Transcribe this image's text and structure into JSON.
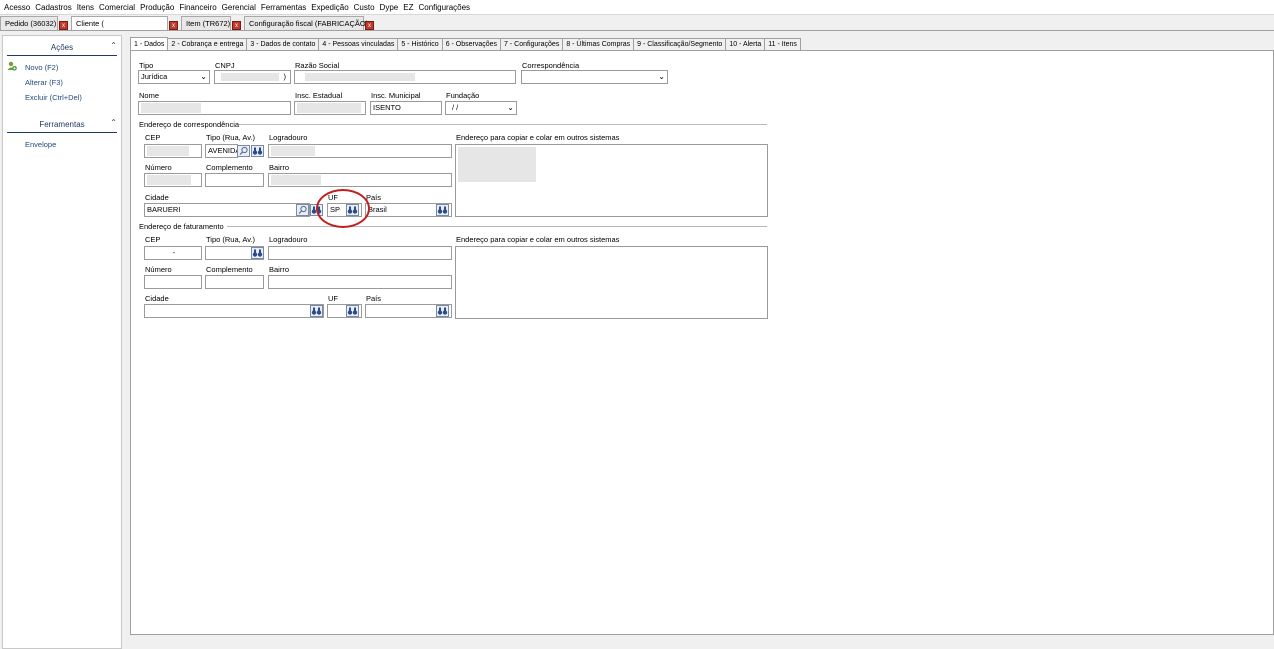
{
  "menu": [
    "Acesso",
    "Cadastros",
    "Itens",
    "Comercial",
    "Produção",
    "Financeiro",
    "Gerencial",
    "Ferramentas",
    "Expedição",
    "Custo",
    "Dype",
    "EZ",
    "Configurações"
  ],
  "doc_tabs": [
    {
      "label": "Pedido (36032)"
    },
    {
      "label": "Cliente (",
      "active": true
    },
    {
      "label": "Item (TR672)"
    },
    {
      "label": "Configuração fiscal (FABRICAÇÃO)"
    }
  ],
  "sidebar": {
    "acoes_title": "Ações",
    "actions": [
      "Novo (F2)",
      "Alterar (F3)",
      "Excluir (Ctrl+Del)"
    ],
    "ferramentas_title": "Ferramentas",
    "tools": [
      "Envelope"
    ]
  },
  "page_tabs": [
    "1 - Dados",
    "2 - Cobrança e entrega",
    "3 - Dados de contato",
    "4 - Pessoas vinculadas",
    "5 - Histórico",
    "6 - Observações",
    "7 - Configurações",
    "8 - Últimas Compras",
    "9 - Classificação/Segmento",
    "10 - Alerta",
    "11 - Itens"
  ],
  "form": {
    "tipo_label": "Tipo",
    "tipo_value": "Jurídica",
    "cnpj_label": "CNPJ",
    "cnpj_tail": ")",
    "razao_label": "Razão Social",
    "correspondencia_label": "Correspondência",
    "nome_label": "Nome",
    "insc_estadual_label": "Insc. Estadual",
    "insc_municipal_label": "Insc. Municipal",
    "insc_municipal_value": "ISENTO",
    "fundacao_label": "Fundação",
    "fundacao_value": "/ /"
  },
  "corresp": {
    "group_title": "Endereço de correspondência",
    "cep_label": "CEP",
    "tipo_label": "Tipo (Rua, Av.)",
    "tipo_value": "AVENIDA",
    "logradouro_label": "Logradouro",
    "copy_label": "Endereço para copiar e colar em outros sistemas",
    "numero_label": "Número",
    "complemento_label": "Complemento",
    "bairro_label": "Bairro",
    "cidade_label": "Cidade",
    "cidade_value": "BARUERI",
    "uf_label": "UF",
    "uf_value": "SP",
    "pais_label": "País",
    "pais_value": "Brasil"
  },
  "fatur": {
    "group_title": "Endereço de faturamento",
    "cep_label": "CEP",
    "cep_value": "-",
    "tipo_label": "Tipo (Rua, Av.)",
    "logradouro_label": "Logradouro",
    "copy_label": "Endereço para copiar e colar em outros sistemas",
    "numero_label": "Número",
    "complemento_label": "Complemento",
    "bairro_label": "Bairro",
    "cidade_label": "Cidade",
    "uf_label": "UF",
    "pais_label": "País"
  },
  "colors": {
    "accent": "#1f4a7a",
    "highlight": "#c02020",
    "close": "#c0392b"
  }
}
